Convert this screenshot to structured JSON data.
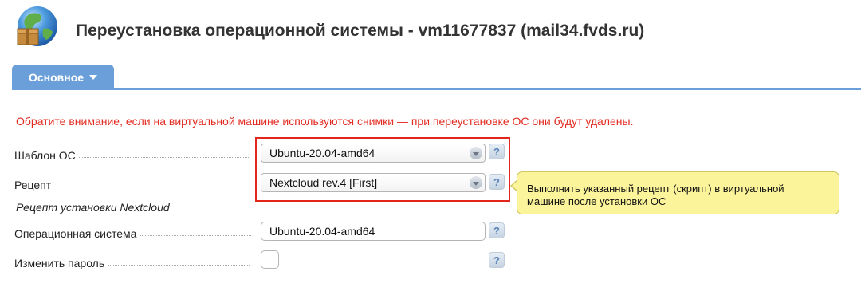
{
  "header": {
    "title": "Переустановка операционной системы - vm11677837 (mail34.fvds.ru)",
    "icon": "globe-install-icon"
  },
  "tabs": [
    {
      "label": "Основное",
      "active": true
    }
  ],
  "warning": "Обратите внимание, если на виртуальной машине используются снимки — при переустановке ОС они будут удалены.",
  "form": {
    "os_template": {
      "label": "Шаблон ОС",
      "value": "Ubuntu-20.04-amd64"
    },
    "recipe": {
      "label": "Рецепт",
      "value": "Nextcloud rev.4 [First]"
    },
    "recipe_section": "Рецепт установки Nextcloud",
    "operating_system": {
      "label": "Операционная система",
      "value": "Ubuntu-20.04-amd64"
    },
    "change_password": {
      "label": "Изменить пароль",
      "checked": false
    },
    "help_glyph": "?"
  },
  "tooltip": {
    "line1": "Выполнить указанный рецепт (скрипт) в виртуальной",
    "line2": "машине после установки ОС"
  },
  "colors": {
    "accent": "#6b9fd9",
    "warning": "#e32c22",
    "highlight": "#e3261c",
    "tooltip_bg": "#fbf49a"
  }
}
